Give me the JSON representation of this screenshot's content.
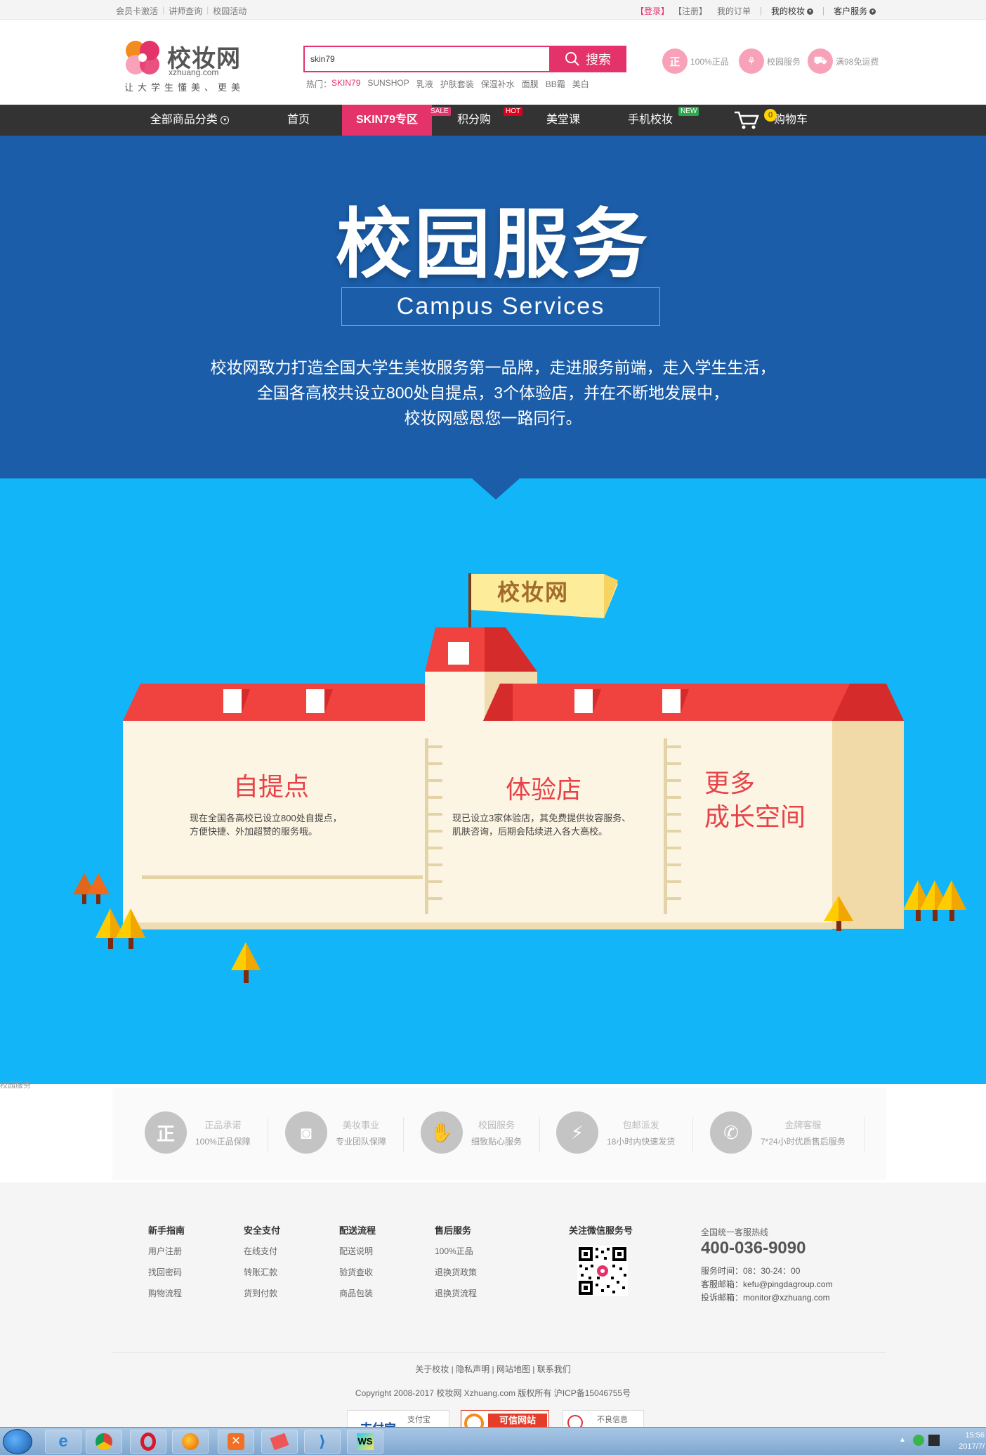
{
  "topbar": {
    "left_links": [
      "会员卡激活",
      "讲师查询",
      "校园活动"
    ],
    "login": "【登录】",
    "register": "【注册】",
    "my_orders": "我的订单",
    "my_account": "我的校妆",
    "customer_service": "客户服务"
  },
  "header": {
    "logo_text": "校妆网",
    "logo_url": "xzhuang.com",
    "logo_slogan": "让大学生懂美、更美",
    "search": {
      "value": "skin79",
      "button_label": "搜索"
    },
    "hot_label": "热门：",
    "hot_keywords": [
      "SKIN79",
      "SUNSHOP",
      "乳液",
      "护肤套装",
      "保湿补水",
      "面膜",
      "BB霜",
      "美白"
    ],
    "features": [
      {
        "icon_text": "正",
        "label": "100%正品"
      },
      {
        "icon_text": "⚘",
        "label": "校园服务"
      },
      {
        "icon_text": "⛟",
        "label": "满98免运费"
      }
    ]
  },
  "nav": {
    "items": [
      "全部商品分类",
      "首页",
      "SKIN79专区",
      "积分购",
      "美堂课",
      "手机校妆"
    ],
    "tags": {
      "sale": "SALE",
      "hot": "HOT",
      "new": "NEW"
    },
    "cart_label": "购物车",
    "cart_count": "0"
  },
  "hero": {
    "title": "校园服务",
    "subtitle": "Campus Services",
    "desc_line1": "校妆网致力打造全国大学生美妆服务第一品牌，走进服务前端，走入学生生活，",
    "desc_line2": "全国各高校共设立800处自提点，3个体验店，并在不断地发展中，",
    "desc_line3": "校妆网感恩您一路同行。"
  },
  "campus": {
    "flag_text": "校妆网",
    "panels": [
      {
        "title": "自提点",
        "text_line1": "现在全国各高校已设立800处自提点，",
        "text_line2": "方便快捷、外加超赞的服务哦。"
      },
      {
        "title": "体验店",
        "text_line1": "现已设立3家体验店，其免费提供妆容服务、",
        "text_line2": "肌肤咨询，后期会陆续进入各大高校。"
      },
      {
        "title_line1": "更多",
        "title_line2": "成长空间"
      }
    ],
    "caption": "校园服务"
  },
  "services": [
    {
      "icon_text": "正",
      "title": "正品承诺",
      "sub": "100%正品保障"
    },
    {
      "icon_text": "◙",
      "title": "美妆事业",
      "sub": "专业团队保障"
    },
    {
      "icon_text": "✋",
      "title": "校园服务",
      "sub": "细致贴心服务"
    },
    {
      "icon_text": "⚡",
      "title": "包邮派发",
      "sub": "18小时内快速发货"
    },
    {
      "icon_text": "✆",
      "title": "金牌客服",
      "sub": "7*24小时优质售后服务"
    }
  ],
  "footer": {
    "columns": [
      {
        "title": "新手指南",
        "items": [
          "用户注册",
          "找回密码",
          "购物流程"
        ]
      },
      {
        "title": "安全支付",
        "items": [
          "在线支付",
          "转账汇款",
          "货到付款"
        ]
      },
      {
        "title": "配送流程",
        "items": [
          "配送说明",
          "验货查收",
          "商品包装"
        ]
      },
      {
        "title": "售后服务",
        "items": [
          "100%正品",
          "退换货政策",
          "退换货流程"
        ]
      }
    ],
    "wechat_title": "关注微信服务号",
    "hotline_label": "全国统一客服热线",
    "hotline": "400-036-9090",
    "service_time": "服务时间：08：30-24：00",
    "service_email": "客服邮箱：kefu@pingdagroup.com",
    "complaint_email": "投诉邮箱：monitor@xzhuang.com",
    "links": [
      "关于校妆",
      "隐私声明",
      "网站地图",
      "联系我们"
    ],
    "copyright": "Copyright 2008-2017 校妆网 Xzhuang.com 版权所有 沪ICP备15046755号",
    "badges": [
      "支付宝",
      "可信网站",
      "不良信息"
    ]
  },
  "taskbar": {
    "time": "15:56",
    "date": "2017/7/"
  },
  "colors": {
    "brand_pink": "#e4336a",
    "nav_dark": "#333333",
    "hero_blue": "#1b5da8",
    "campus_blue": "#12b5f7",
    "roof_red": "#f0433f",
    "wall_cream": "#fdf5e3"
  }
}
